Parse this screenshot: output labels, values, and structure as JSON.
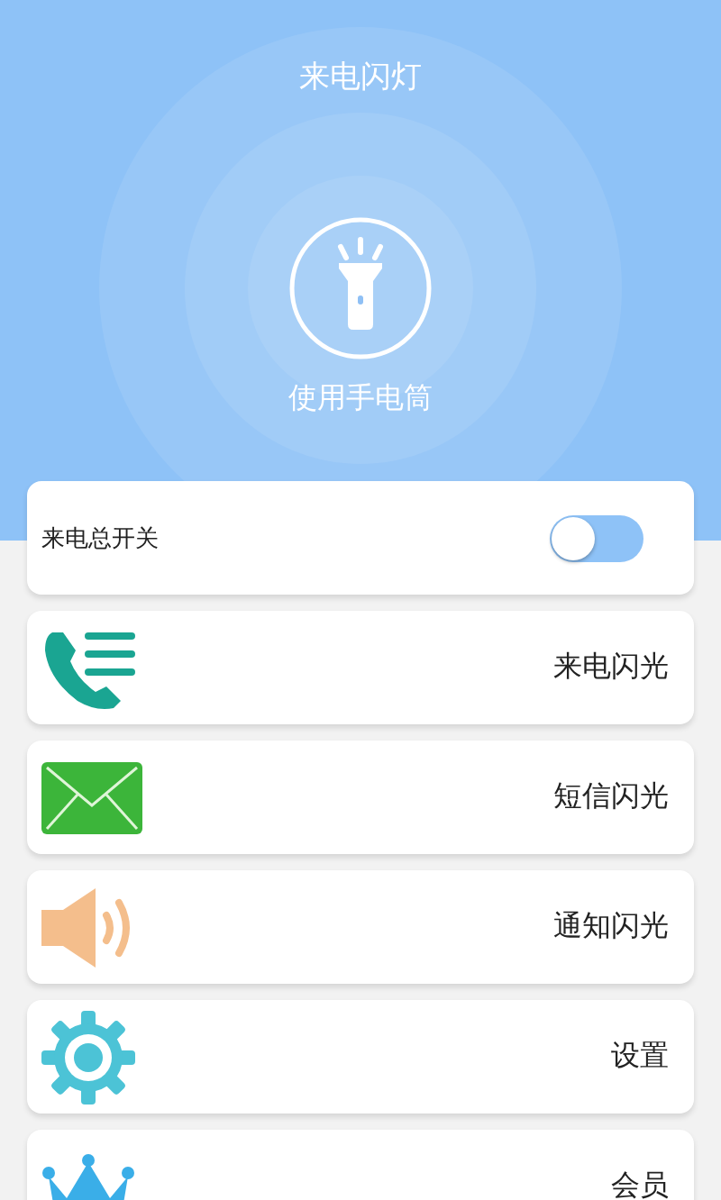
{
  "header": {
    "title": "来电闪灯",
    "flashlight_label": "使用手电筒"
  },
  "master_switch": {
    "label": "来电总开关",
    "on": false
  },
  "menu": [
    {
      "kind": "phone",
      "label": "来电闪光"
    },
    {
      "kind": "mail",
      "label": "短信闪光"
    },
    {
      "kind": "speaker",
      "label": "通知闪光"
    },
    {
      "kind": "gear",
      "label": "设置"
    },
    {
      "kind": "crown",
      "label": "会员"
    }
  ]
}
